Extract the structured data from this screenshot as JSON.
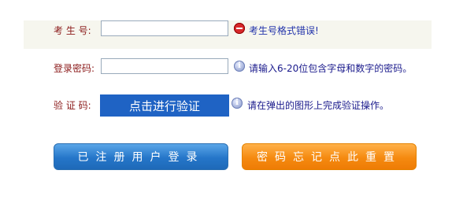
{
  "candidate": {
    "label": "考 生 号:",
    "value": "",
    "error_icon": "error-minus-icon",
    "error_text": "考生号格式错误!"
  },
  "password": {
    "label": "登录密码:",
    "value": "",
    "info_icon": "info-icon",
    "hint": "请输入6-20位包含字母和数字的密码。"
  },
  "captcha": {
    "label": "验 证 码:",
    "button": "点击进行验证",
    "info_icon": "info-icon",
    "hint": "请在弹出的图形上完成验证操作。"
  },
  "actions": {
    "login": "已注册用户登录",
    "reset": "密码忘记点此重置"
  },
  "colors": {
    "label": "#8b1a1a",
    "hint": "#1a1a8c",
    "verify_button": "#1f63c4",
    "login_button": "#2576c9",
    "reset_button": "#f58a10"
  }
}
